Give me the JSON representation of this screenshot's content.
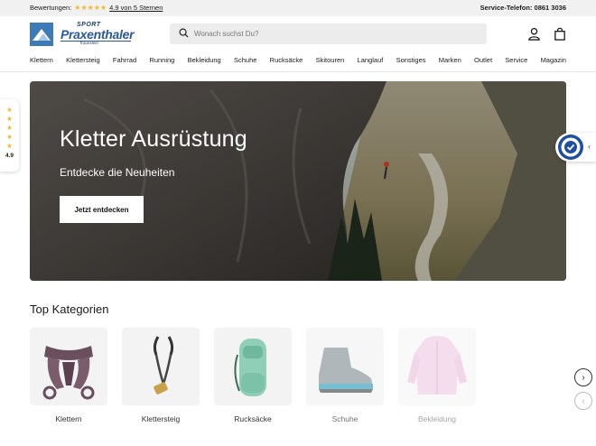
{
  "topbar": {
    "ratings_label": "Bewertungen:",
    "stars": "★★★★★",
    "rating_text": "4.9 von 5 Sternen",
    "phone": "Service-Telefon: 0861 3036"
  },
  "logo": {
    "sport": "SPORT",
    "brand": "Praxenthaler",
    "location": "Traunstein"
  },
  "search": {
    "placeholder": "Wonach suchst Du?"
  },
  "nav": {
    "items": [
      "Klettern",
      "Klettersteig",
      "Fahrrad",
      "Running",
      "Bekleidung",
      "Schuhe",
      "Rucksäcke",
      "Skitouren",
      "Langlauf",
      "Sonstiges",
      "Marken",
      "Outlet",
      "Service",
      "Magazin"
    ]
  },
  "rating_badge": {
    "stars": [
      "★",
      "★",
      "★",
      "★",
      "★"
    ],
    "value": "4.9"
  },
  "hero": {
    "title": "Kletter Ausrüstung",
    "subtitle": "Entdecke die Neuheiten",
    "button": "Jetzt entdecken"
  },
  "categories": {
    "title": "Top Kategorien",
    "items": [
      "Klettern",
      "Klettersteig",
      "Rucksäcke",
      "Schuhe",
      "Bekleidung"
    ]
  },
  "colors": {
    "accent": "#3d7ab8",
    "star": "#f0b82d",
    "trusted": "#1f4fa0"
  },
  "icons": {
    "search": "search-icon",
    "account": "user-icon",
    "cart": "shopping-bag-icon",
    "next": "chevron-right-icon",
    "prev": "chevron-left-icon"
  }
}
